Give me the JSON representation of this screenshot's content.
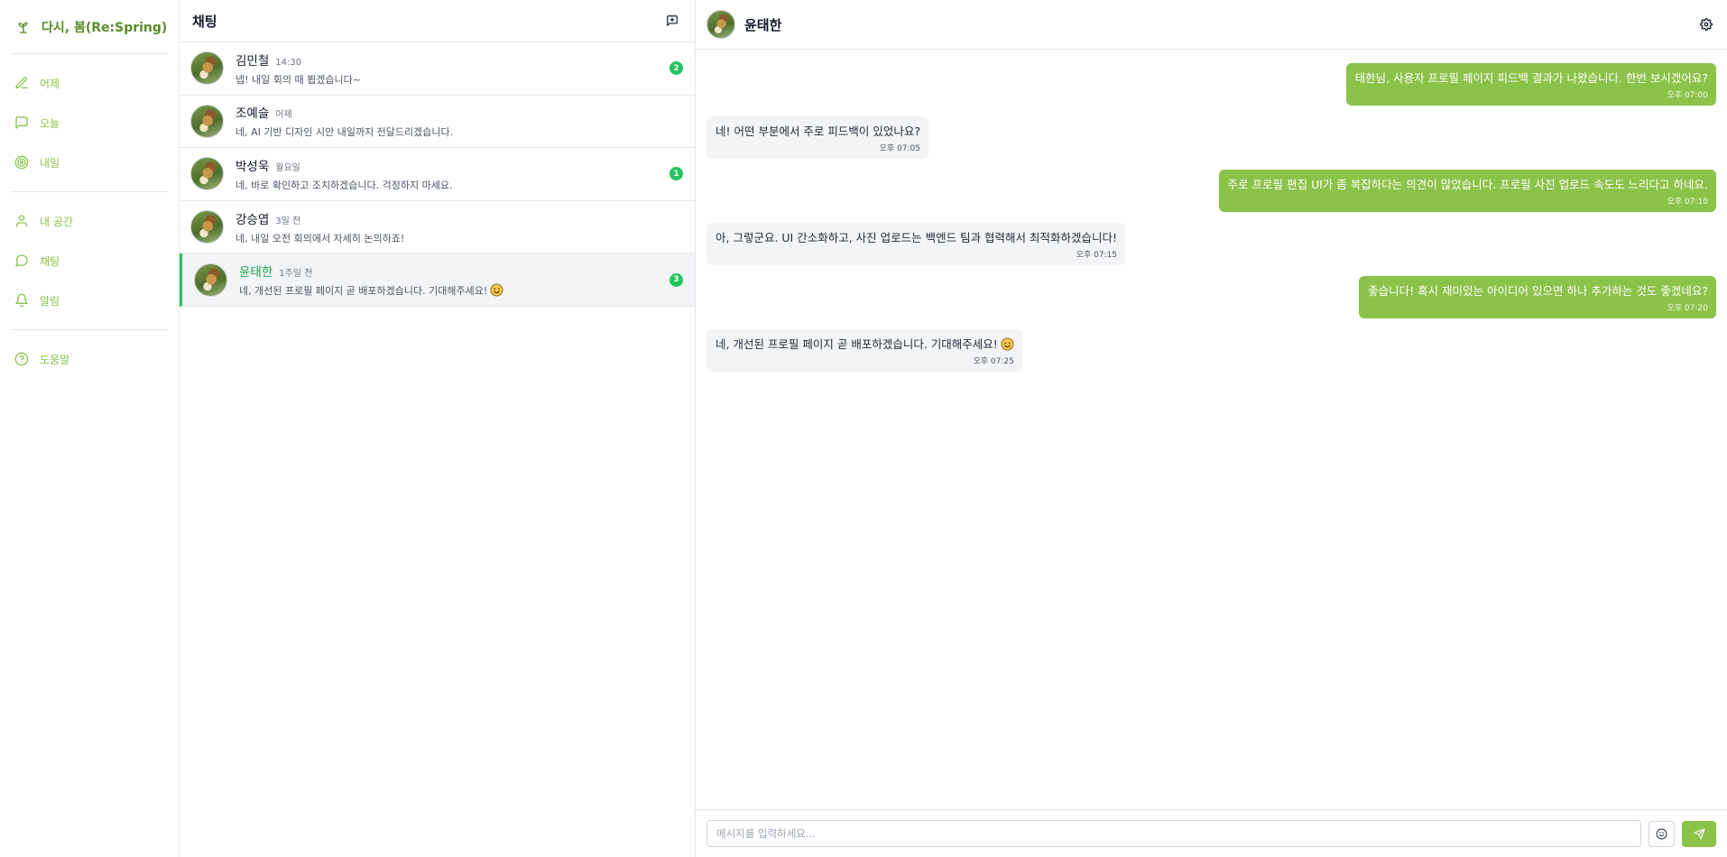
{
  "app": {
    "brand_title": "다시, 봄(Re:Spring)"
  },
  "nav": {
    "groups": [
      [
        {
          "label": "어제",
          "icon": "pencil-icon"
        },
        {
          "label": "오늘",
          "icon": "chat-bubble-icon"
        },
        {
          "label": "내일",
          "icon": "target-icon"
        }
      ],
      [
        {
          "label": "내 공간",
          "icon": "user-icon"
        },
        {
          "label": "채팅",
          "icon": "chat-round-icon"
        },
        {
          "label": "알림",
          "icon": "bell-icon"
        }
      ],
      [
        {
          "label": "도움말",
          "icon": "help-circle-icon"
        }
      ]
    ],
    "accent_color": "#8bc34a"
  },
  "chat_list": {
    "title": "채팅",
    "items": [
      {
        "name": "김민철",
        "time": "14:30",
        "preview": "넵! 내일 회의 때 뵙겠습니다~",
        "unread": "2",
        "active": false
      },
      {
        "name": "조예슬",
        "time": "어제",
        "preview": "네, AI 기반 디자인 시안 내일까지 전달드리겠습니다.",
        "unread": "",
        "active": false
      },
      {
        "name": "박성욱",
        "time": "월요일",
        "preview": "네, 바로 확인하고 조치하겠습니다. 걱정하지 마세요.",
        "unread": "1",
        "active": false
      },
      {
        "name": "강승엽",
        "time": "3일 전",
        "preview": "네, 내일 오전 회의에서 자세히 논의하죠!",
        "unread": "",
        "active": false
      },
      {
        "name": "윤태한",
        "time": "1주일 전",
        "preview": "네, 개선된 프로필 페이지 곧 배포하겠습니다. 기대해주세요!",
        "unread": "3",
        "active": true,
        "emoji": "smile-emoji"
      }
    ]
  },
  "conversation": {
    "name": "윤태한",
    "messages": [
      {
        "dir": "out",
        "text": "태한님, 사용자 프로필 페이지 피드백 결과가 나왔습니다. 한번 보시겠어요?",
        "time": "오후 07:00"
      },
      {
        "dir": "in",
        "text": "네! 어떤 부분에서 주로 피드백이 있었나요?",
        "time": "오후 07:05"
      },
      {
        "dir": "out",
        "text": "주로 프로필 편집 UI가 좀 복잡하다는 의견이 많았습니다. 프로필 사진 업로드 속도도 느리다고 하네요.",
        "time": "오후 07:10"
      },
      {
        "dir": "in",
        "text": "아, 그렇군요. UI 간소화하고, 사진 업로드는 백엔드 팀과 협력해서 최적화하겠습니다!",
        "time": "오후 07:15"
      },
      {
        "dir": "out",
        "text": "좋습니다! 혹시 재미있는 아이디어 있으면 하나 추가하는 것도 좋겠네요?",
        "time": "오후 07:20"
      },
      {
        "dir": "in",
        "text": "네, 개선된 프로필 페이지 곧 배포하겠습니다. 기대해주세요!",
        "time": "오후 07:25",
        "emoji": "smile-emoji"
      }
    ],
    "composer_placeholder": "메시지를 입력하세요..."
  },
  "colors": {
    "outgoing_bubble": "#8bc34a",
    "incoming_bubble": "#f3f4f6",
    "badge": "#22c55e",
    "active_indicator": "#22c55e"
  }
}
